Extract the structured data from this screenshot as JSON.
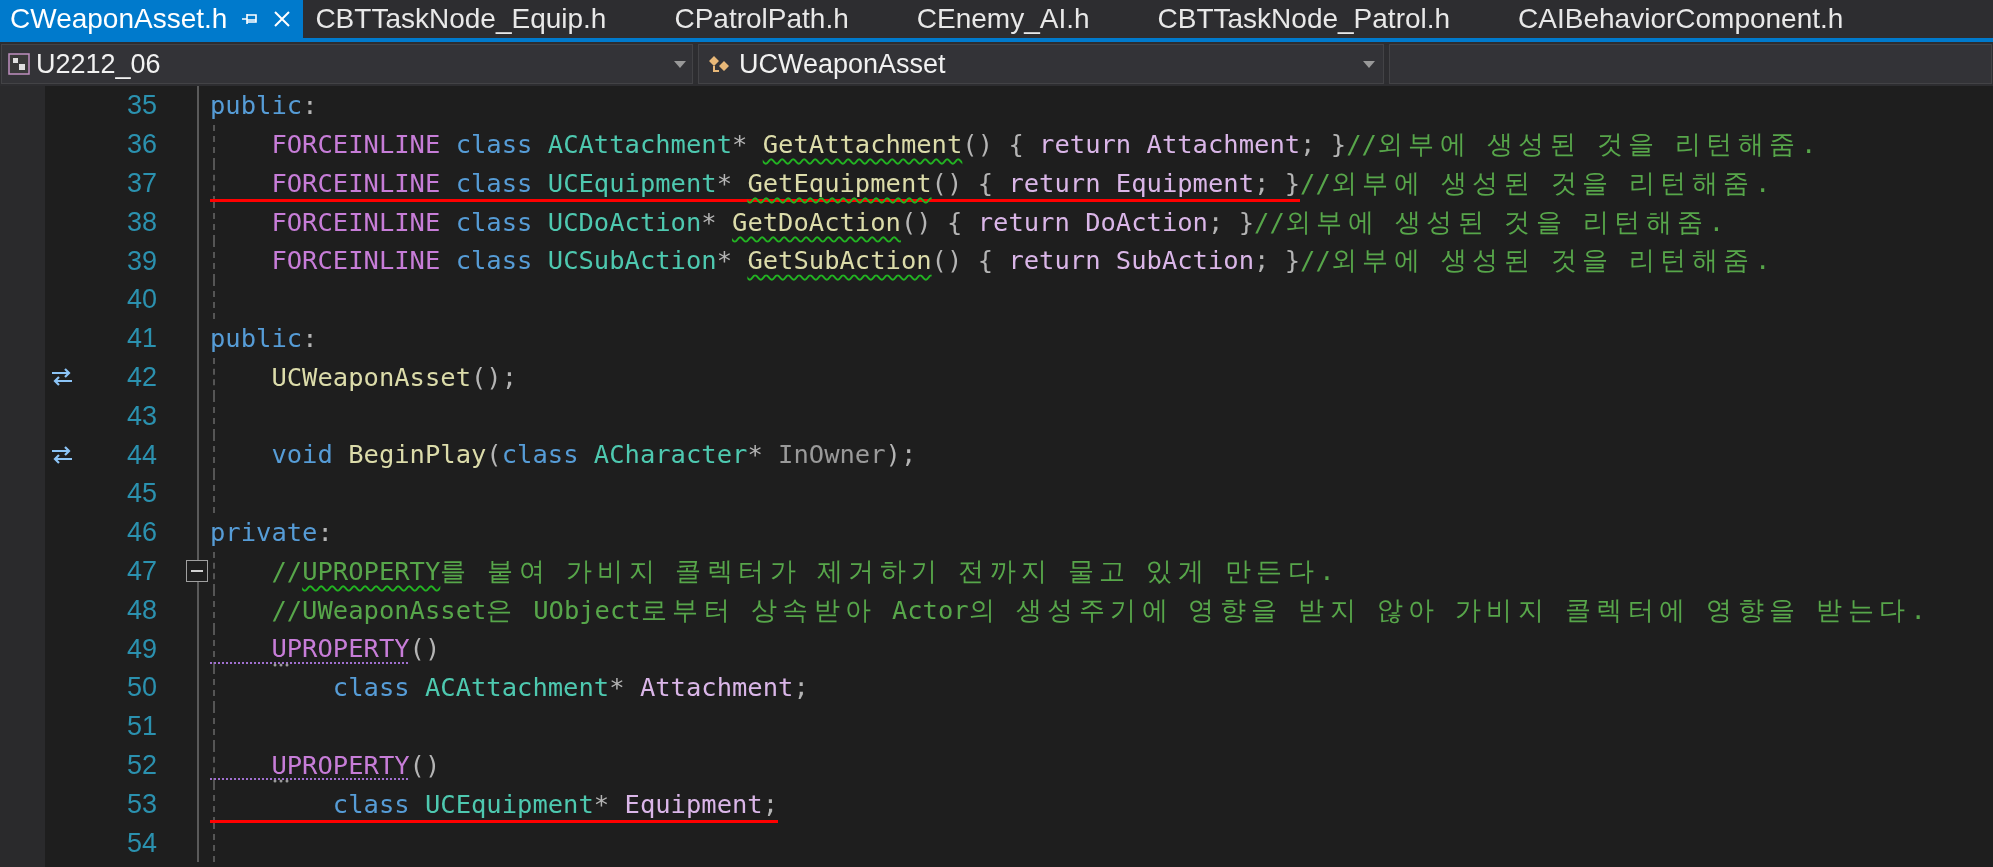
{
  "tabs": [
    {
      "label": "CWeaponAsset.h",
      "selected": true,
      "pinned": true
    },
    {
      "label": "CBTTaskNode_Equip.h",
      "selected": false,
      "pinned": false
    },
    {
      "label": "CPatrolPath.h",
      "selected": false,
      "pinned": false
    },
    {
      "label": "CEnemy_AI.h",
      "selected": false,
      "pinned": false
    },
    {
      "label": "CBTTaskNode_Patrol.h",
      "selected": false,
      "pinned": false
    },
    {
      "label": "CAIBehaviorComponent.h",
      "selected": false,
      "pinned": false
    }
  ],
  "navigation": {
    "project": "U2212_06",
    "scope": "UCWeaponAsset"
  },
  "lines": [
    {
      "number": "35",
      "kind": "plain",
      "guide": false,
      "underlined": false,
      "collapsed_hint": false,
      "tokens": [
        {
          "t": "public",
          "kind": "keyword",
          "squiggled": false
        },
        {
          "t": ":",
          "kind": "punct",
          "squiggled": false
        }
      ]
    },
    {
      "number": "36",
      "kind": "plain",
      "guide": true,
      "underlined": false,
      "collapsed_hint": false,
      "tokens": [
        {
          "t": "    FORCEINLINE",
          "kind": "macro",
          "squiggled": false
        },
        {
          "t": " class",
          "kind": "keyword",
          "squiggled": false
        },
        {
          "t": " ACAttachment",
          "kind": "type",
          "squiggled": false
        },
        {
          "t": "* ",
          "kind": "punct",
          "squiggled": false
        },
        {
          "t": "GetAttachment",
          "kind": "function",
          "squiggled": true
        },
        {
          "t": "() { ",
          "kind": "punct",
          "squiggled": false
        },
        {
          "t": "return Attachment",
          "kind": "member",
          "squiggled": false
        },
        {
          "t": "; }",
          "kind": "punct",
          "squiggled": false
        },
        {
          "t": "//외부에 생성된 것을 리턴해줌.",
          "kind": "comment",
          "squiggled": false
        }
      ]
    },
    {
      "number": "37",
      "kind": "plain",
      "guide": true,
      "underlined": true,
      "collapsed_hint": false,
      "tokens": [
        {
          "t": "    FORCEINLINE",
          "kind": "macro",
          "squiggled": false
        },
        {
          "t": " class",
          "kind": "keyword",
          "squiggled": false
        },
        {
          "t": " UCEquipment",
          "kind": "type",
          "squiggled": false
        },
        {
          "t": "* ",
          "kind": "punct",
          "squiggled": false
        },
        {
          "t": "GetEquipment",
          "kind": "function",
          "squiggled": true
        },
        {
          "t": "() { ",
          "kind": "punct",
          "squiggled": false
        },
        {
          "t": "return Equipment",
          "kind": "member",
          "squiggled": false
        },
        {
          "t": "; }",
          "kind": "punct",
          "squiggled": false
        },
        {
          "t": "//외부에 생성된 것을 리턴해줌.",
          "kind": "comment",
          "squiggled": false
        }
      ]
    },
    {
      "number": "38",
      "kind": "plain",
      "guide": true,
      "underlined": false,
      "collapsed_hint": false,
      "tokens": [
        {
          "t": "    FORCEINLINE",
          "kind": "macro",
          "squiggled": false
        },
        {
          "t": " class",
          "kind": "keyword",
          "squiggled": false
        },
        {
          "t": " UCDoAction",
          "kind": "type",
          "squiggled": false
        },
        {
          "t": "* ",
          "kind": "punct",
          "squiggled": false
        },
        {
          "t": "GetDoAction",
          "kind": "function",
          "squiggled": true
        },
        {
          "t": "() { ",
          "kind": "punct",
          "squiggled": false
        },
        {
          "t": "return DoAction",
          "kind": "member",
          "squiggled": false
        },
        {
          "t": "; }",
          "kind": "punct",
          "squiggled": false
        },
        {
          "t": "//외부에 생성된 것을 리턴해줌.",
          "kind": "comment",
          "squiggled": false
        }
      ]
    },
    {
      "number": "39",
      "kind": "plain",
      "guide": true,
      "underlined": false,
      "collapsed_hint": false,
      "tokens": [
        {
          "t": "    FORCEINLINE",
          "kind": "macro",
          "squiggled": false
        },
        {
          "t": " class",
          "kind": "keyword",
          "squiggled": false
        },
        {
          "t": " UCSubAction",
          "kind": "type",
          "squiggled": false
        },
        {
          "t": "* ",
          "kind": "punct",
          "squiggled": false
        },
        {
          "t": "GetSubAction",
          "kind": "function",
          "squiggled": true
        },
        {
          "t": "() { ",
          "kind": "punct",
          "squiggled": false
        },
        {
          "t": "return SubAction",
          "kind": "member",
          "squiggled": false
        },
        {
          "t": "; }",
          "kind": "punct",
          "squiggled": false
        },
        {
          "t": "//외부에 생성된 것을 리턴해줌.",
          "kind": "comment",
          "squiggled": false
        }
      ]
    },
    {
      "number": "40",
      "kind": "plain",
      "guide": true,
      "underlined": false,
      "collapsed_hint": false
    },
    {
      "number": "41",
      "kind": "plain",
      "guide": false,
      "underlined": false,
      "collapsed_hint": false,
      "tokens": [
        {
          "t": "public",
          "kind": "keyword",
          "squiggled": false
        },
        {
          "t": ":",
          "kind": "punct",
          "squiggled": false
        }
      ]
    },
    {
      "number": "42",
      "kind": "link",
      "guide": true,
      "underlined": false,
      "collapsed_hint": false,
      "tokens": [
        {
          "t": "    UCWeaponAsset",
          "kind": "function",
          "squiggled": false
        },
        {
          "t": "();",
          "kind": "punct",
          "squiggled": false
        }
      ]
    },
    {
      "number": "43",
      "kind": "plain",
      "guide": true,
      "underlined": false,
      "collapsed_hint": false
    },
    {
      "number": "44",
      "kind": "link",
      "guide": true,
      "underlined": false,
      "collapsed_hint": false,
      "tokens": [
        {
          "t": "    void",
          "kind": "keyword",
          "squiggled": false
        },
        {
          "t": " BeginPlay",
          "kind": "function",
          "squiggled": false
        },
        {
          "t": "(",
          "kind": "punct",
          "squiggled": false
        },
        {
          "t": "class",
          "kind": "keyword",
          "squiggled": false
        },
        {
          "t": " ACharacter",
          "kind": "type",
          "squiggled": false
        },
        {
          "t": "* ",
          "kind": "punct",
          "squiggled": false
        },
        {
          "t": "InOwner",
          "kind": "param",
          "squiggled": false
        },
        {
          "t": ");",
          "kind": "punct",
          "squiggled": false
        }
      ]
    },
    {
      "number": "45",
      "kind": "plain",
      "guide": true,
      "underlined": false,
      "collapsed_hint": false
    },
    {
      "number": "46",
      "kind": "plain",
      "guide": false,
      "underlined": false,
      "collapsed_hint": false,
      "tokens": [
        {
          "t": "private",
          "kind": "keyword",
          "squiggled": false
        },
        {
          "t": ":",
          "kind": "punct",
          "squiggled": false
        }
      ]
    },
    {
      "number": "47",
      "kind": "fold",
      "guide": true,
      "underlined": false,
      "collapsed_hint": false,
      "tokens": [
        {
          "t": "    //",
          "kind": "comment",
          "squiggled": false
        },
        {
          "t": "UPROPERTY",
          "kind": "comment",
          "squiggled": true
        },
        {
          "t": "를 붙여 가비지 콜렉터가 제거하기 전까지 물고 있게 만든다.",
          "kind": "comment",
          "squiggled": false
        }
      ]
    },
    {
      "number": "48",
      "kind": "plain",
      "guide": true,
      "underlined": false,
      "collapsed_hint": false,
      "tokens": [
        {
          "t": "    //UWeaponAsset은 UObject로부터 상속받아 Actor의 생성주기에 영향을 받지 않아 가비지 콜렉터에 영향을 받는다.",
          "kind": "comment",
          "squiggled": false
        }
      ]
    },
    {
      "number": "49",
      "kind": "plain",
      "guide": true,
      "underlined": false,
      "collapsed_hint": true,
      "tokens": [
        {
          "t": "    UPROPERTY",
          "kind": "macro",
          "squiggled": true
        },
        {
          "t": "()",
          "kind": "punct",
          "squiggled": false
        }
      ]
    },
    {
      "number": "50",
      "kind": "plain",
      "guide": true,
      "underlined": false,
      "collapsed_hint": false,
      "tokens": [
        {
          "t": "        class",
          "kind": "keyword",
          "squiggled": false
        },
        {
          "t": " ACAttachment",
          "kind": "type",
          "squiggled": false
        },
        {
          "t": "* ",
          "kind": "punct",
          "squiggled": false
        },
        {
          "t": "Attachment",
          "kind": "member",
          "squiggled": false
        },
        {
          "t": ";",
          "kind": "punct",
          "squiggled": false
        }
      ]
    },
    {
      "number": "51",
      "kind": "plain",
      "guide": true,
      "underlined": false,
      "collapsed_hint": false
    },
    {
      "number": "52",
      "kind": "plain",
      "guide": true,
      "underlined": false,
      "collapsed_hint": true,
      "tokens": [
        {
          "t": "    UPROPERTY",
          "kind": "macro",
          "squiggled": true
        },
        {
          "t": "()",
          "kind": "punct",
          "squiggled": false
        }
      ]
    },
    {
      "number": "53",
      "kind": "plain",
      "guide": true,
      "underlined": true,
      "collapsed_hint": false,
      "tokens": [
        {
          "t": "        class",
          "kind": "keyword",
          "squiggled": false
        },
        {
          "t": " UCEquipment",
          "kind": "type",
          "squiggled": false
        },
        {
          "t": "* ",
          "kind": "punct",
          "squiggled": false
        },
        {
          "t": "Equipment",
          "kind": "member",
          "squiggled": false
        },
        {
          "t": ";",
          "kind": "punct",
          "squiggled": false
        }
      ]
    },
    {
      "number": "54",
      "kind": "plain",
      "guide": true,
      "underlined": false,
      "collapsed_hint": false
    }
  ]
}
